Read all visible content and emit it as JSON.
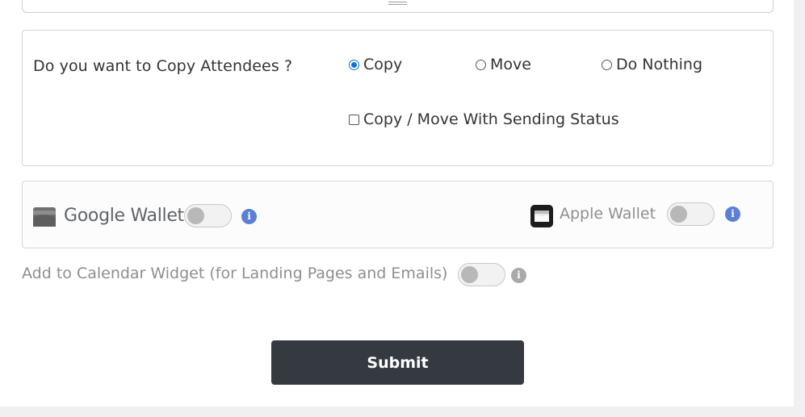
{
  "copy_attendees": {
    "question": "Do you want to Copy Attendees ?",
    "options": [
      {
        "label": "Copy",
        "selected": true
      },
      {
        "label": "Move",
        "selected": false
      },
      {
        "label": "Do Nothing",
        "selected": false
      }
    ],
    "sending_status_label": "Copy / Move With Sending Status",
    "sending_status_checked": false
  },
  "wallets": {
    "google": {
      "label": "Google Wallet",
      "enabled": false
    },
    "apple": {
      "label": "Apple Wallet",
      "enabled": false
    },
    "info_icon": "info-icon"
  },
  "calendar_widget": {
    "label": "Add to Calendar Widget (for Landing Pages and Emails)",
    "enabled": false
  },
  "submit_label": "Submit",
  "colors": {
    "radio_accent": "#0b73d9",
    "info_blue": "#5b7fd6",
    "submit_bg": "#343a40"
  }
}
